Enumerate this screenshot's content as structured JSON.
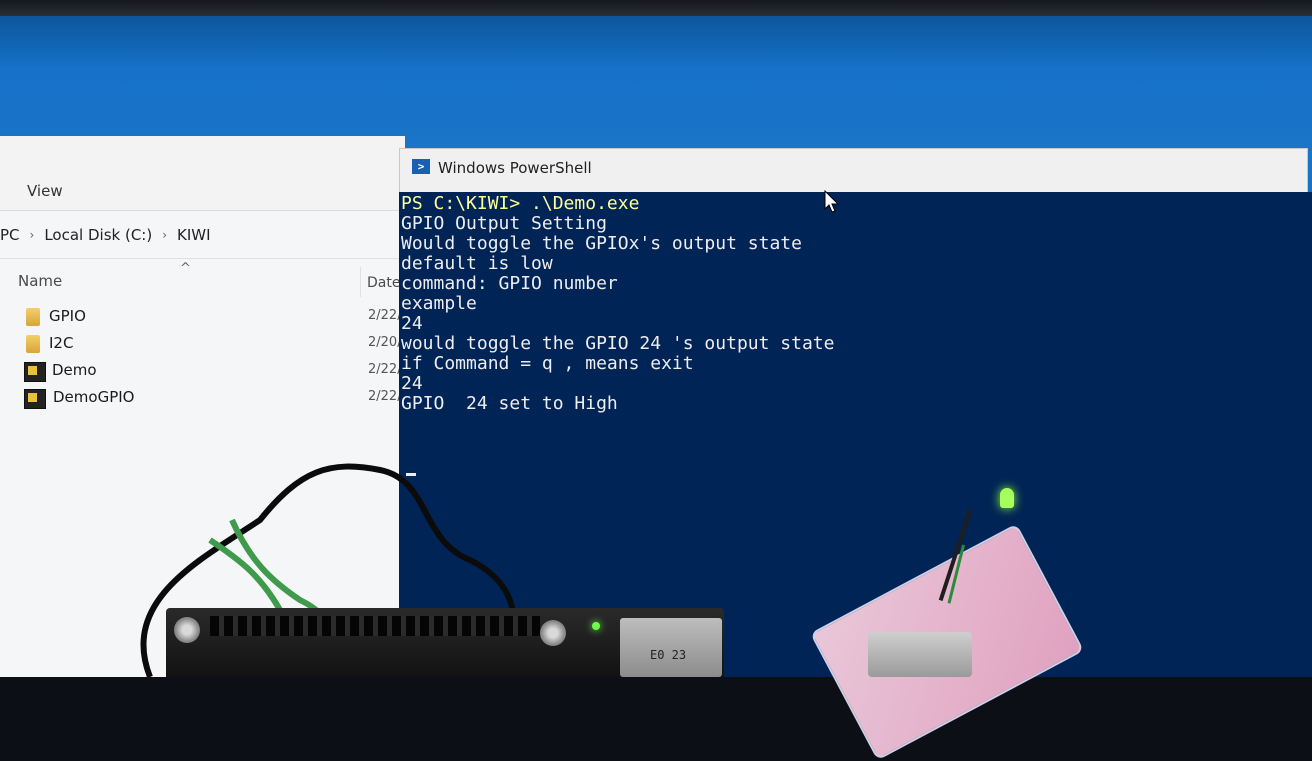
{
  "explorer": {
    "view_label": "View",
    "breadcrumb": [
      "PC",
      "Local Disk (C:)",
      "KIWI"
    ],
    "columns": {
      "name": "Name",
      "date": "Date"
    },
    "files": [
      {
        "name": "GPIO",
        "date": "2/22/",
        "icon": "folder-icon"
      },
      {
        "name": "I2C",
        "date": "2/20/",
        "icon": "folder-icon"
      },
      {
        "name": "Demo",
        "date": "2/22/",
        "icon": "exe-icon"
      },
      {
        "name": "DemoGPIO",
        "date": "2/22/",
        "icon": "exe-icon"
      }
    ]
  },
  "powershell": {
    "title": "Windows PowerShell",
    "lines": [
      "PS C:\\KIWI> .\\Demo.exe",
      "GPIO Output Setting",
      "Would toggle the GPIOx's output state",
      "default is low",
      "command: GPIO number",
      "example",
      "24",
      "would toggle the GPIO 24 's output state",
      "if Command = q , means exit",
      "24",
      "GPIO  24 set to High"
    ],
    "colors": {
      "background": "#012456",
      "text": "#eeedf0",
      "command": "#fefe9d"
    }
  },
  "hardware": {
    "board_text": "E0 23"
  }
}
